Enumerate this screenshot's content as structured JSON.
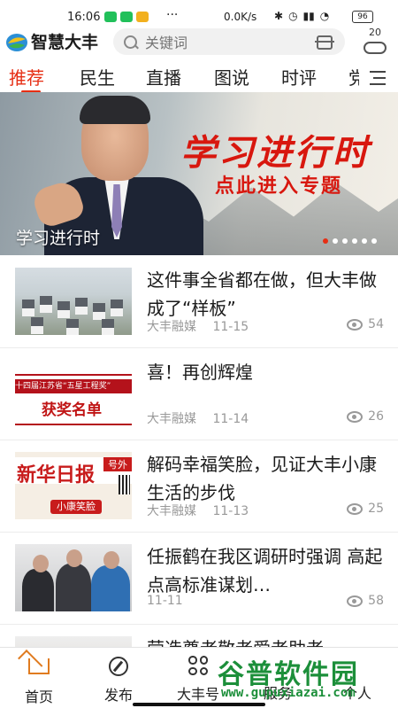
{
  "status_bar": {
    "time": "16:06",
    "dots": "···",
    "network_speed": "0.0K/s",
    "battery": "96"
  },
  "header": {
    "app_name": "智慧大丰",
    "search_placeholder": "关键词",
    "weather_temp": "20"
  },
  "tabs": [
    {
      "label": "推荐",
      "active": true
    },
    {
      "label": "民生"
    },
    {
      "label": "直播"
    },
    {
      "label": "图说"
    },
    {
      "label": "时评"
    },
    {
      "label": "党"
    }
  ],
  "banner": {
    "title": "学习进行时",
    "subtitle": "点此进入专题",
    "caption": "学习进行时",
    "slide_count": 6,
    "active_slide": 1
  },
  "news": [
    {
      "title": "这件事全省都在做，但大丰做成了“样板”",
      "source": "大丰融媒",
      "date": "11-15",
      "views": "54"
    },
    {
      "title": "喜！再创辉煌",
      "source": "大丰融媒",
      "date": "11-14",
      "views": "26",
      "thumb_banner": "十四届江苏省“五星工程奖”",
      "thumb_word": "获奖名单"
    },
    {
      "title": "解码幸福笑脸，见证大丰小康生活的步伐",
      "source": "大丰融媒",
      "date": "11-13",
      "views": "25",
      "thumb_name": "新华日报",
      "thumb_tag": "号外",
      "thumb_stamp": "小康笑脸"
    },
    {
      "title": "任振鹤在我区调研时强调 高起点高标准谋划…",
      "source": "",
      "date": "11-11",
      "views": "58"
    },
    {
      "title": "营造尊老敬老爱老助老"
    }
  ],
  "bottom_nav": [
    {
      "label": "首页",
      "icon": "home-icon",
      "active": true
    },
    {
      "label": "发布",
      "icon": "compass-icon"
    },
    {
      "label": "大丰号",
      "icon": "grid-icon"
    },
    {
      "label": "服务",
      "icon": "service-icon"
    },
    {
      "label": "个人",
      "icon": "user-icon"
    }
  ],
  "watermark": {
    "text": "谷普软件园",
    "url": "www.gupuxiazai.com"
  },
  "colors": {
    "accent": "#e62e14",
    "banner_red": "#d8170e",
    "home_orange": "#e07b1f",
    "watermark_green": "#1c8f3a"
  }
}
